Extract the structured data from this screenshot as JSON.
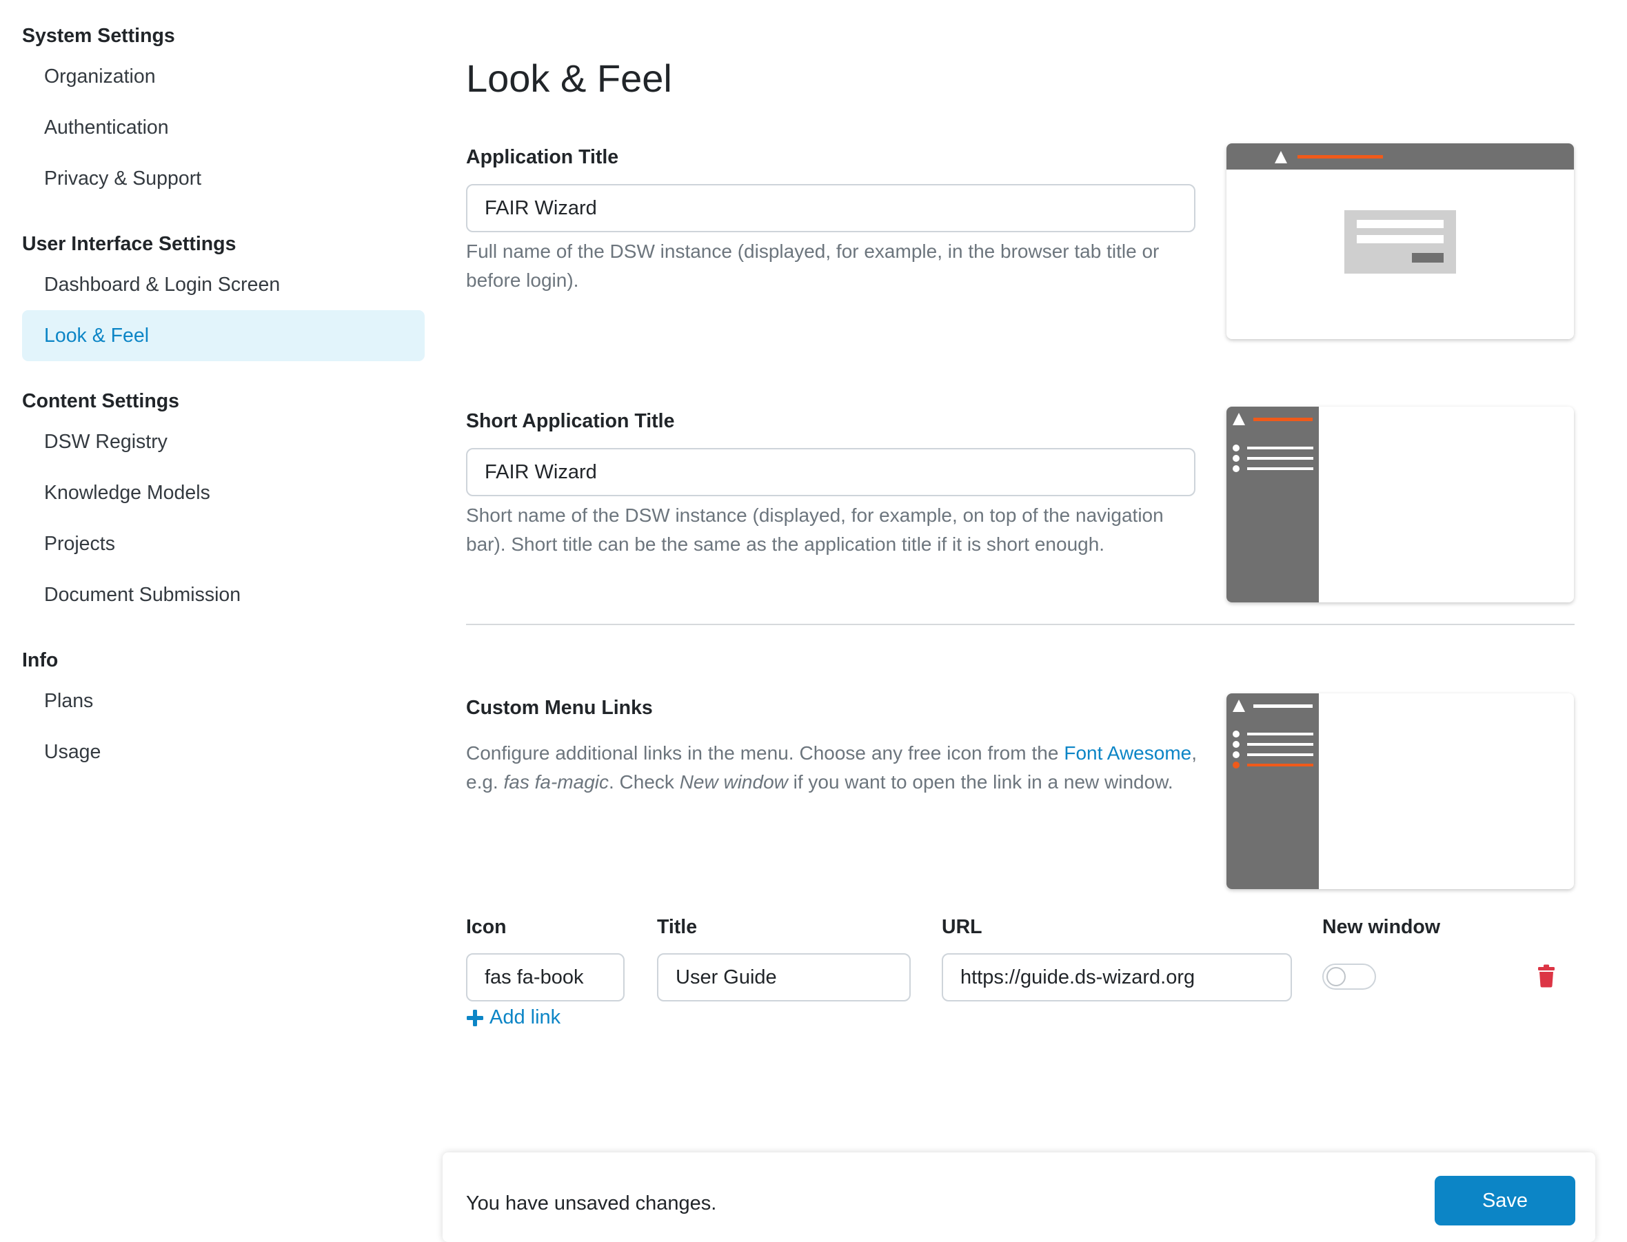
{
  "sidebar": {
    "sections": [
      {
        "heading": "System Settings",
        "items": [
          "Organization",
          "Authentication",
          "Privacy & Support"
        ]
      },
      {
        "heading": "User Interface Settings",
        "items": [
          "Dashboard & Login Screen",
          "Look & Feel"
        ]
      },
      {
        "heading": "Content Settings",
        "items": [
          "DSW Registry",
          "Knowledge Models",
          "Projects",
          "Document Submission"
        ]
      },
      {
        "heading": "Info",
        "items": [
          "Plans",
          "Usage"
        ]
      }
    ],
    "active_item": "Look & Feel"
  },
  "page": {
    "title": "Look & Feel"
  },
  "app_title": {
    "label": "Application Title",
    "value": "FAIR Wizard",
    "help": "Full name of the DSW instance (displayed, for example, in the browser tab title or before login)."
  },
  "short_title": {
    "label": "Short Application Title",
    "value": "FAIR Wizard",
    "help": "Short name of the DSW instance (displayed, for example, on top of the navigation bar). Short title can be the same as the application title if it is short enough."
  },
  "menu_links": {
    "label": "Custom Menu Links",
    "help_prefix": "Configure additional links in the menu. Choose any free icon from the ",
    "help_link": "Font Awesome",
    "help_mid1": ", e.g. ",
    "help_example": "fas fa-magic",
    "help_mid2": ". Check ",
    "help_new_window": "New window",
    "help_suffix": " if you want to open the link in a new window.",
    "columns": {
      "icon": "Icon",
      "title": "Title",
      "url": "URL",
      "new_window": "New window"
    },
    "rows": [
      {
        "icon": "fas fa-book",
        "title": "User Guide",
        "url": "https://guide.ds-wizard.org",
        "new_window": false
      }
    ],
    "add_label": "Add link"
  },
  "save_bar": {
    "message": "You have unsaved changes.",
    "button": "Save"
  },
  "colors": {
    "accent": "#0c85c6",
    "active_bg": "#e2f4fb",
    "preview_gray": "#707070",
    "highlight": "#f05a1a",
    "danger": "#dc3545"
  }
}
